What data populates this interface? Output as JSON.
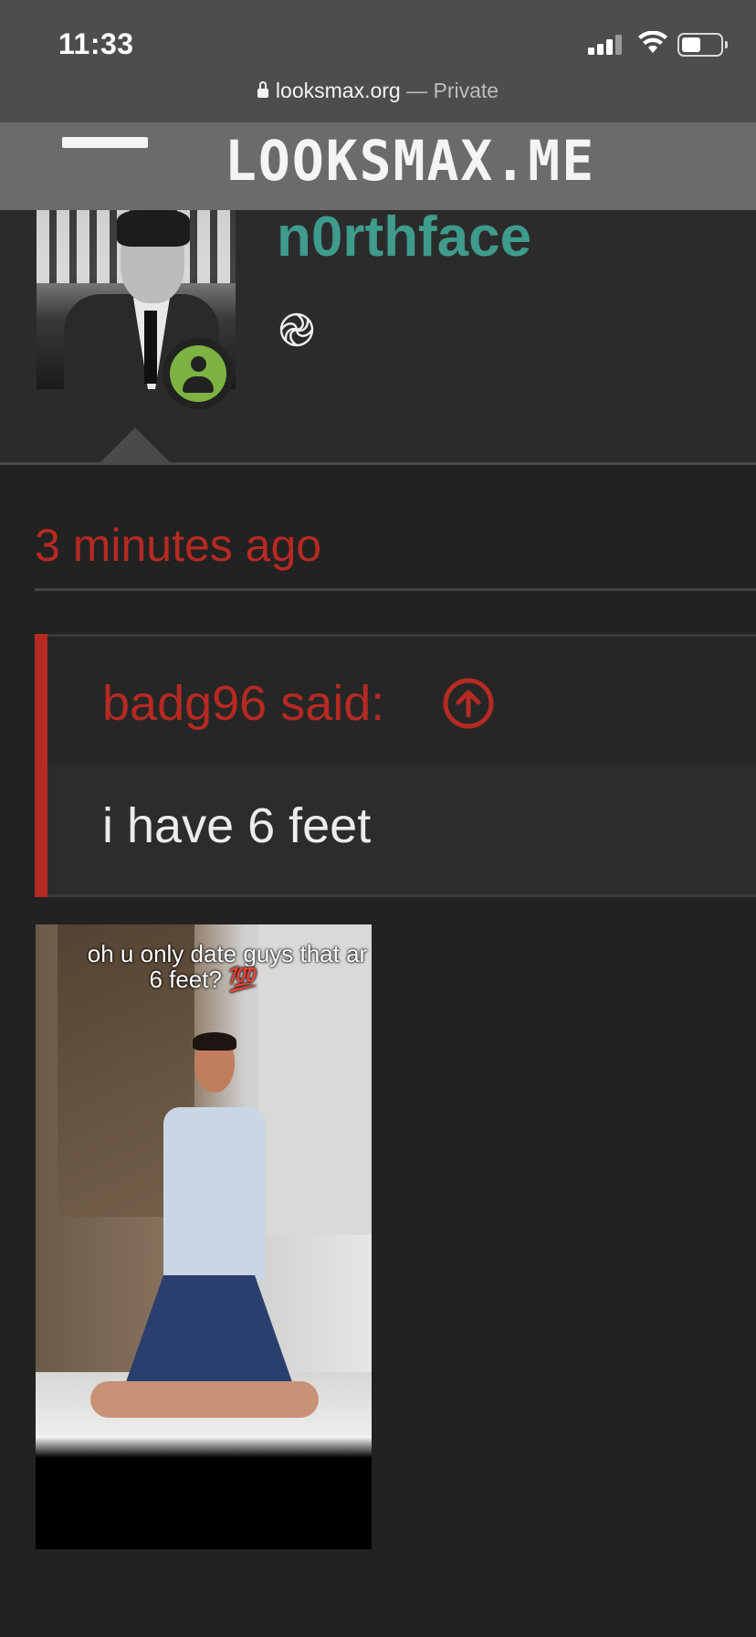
{
  "status_bar": {
    "time": "11:33"
  },
  "url_bar": {
    "domain": "looksmax.org",
    "separator": " — ",
    "mode": "Private"
  },
  "site": {
    "logo_text": "LOOKSMAX.ME"
  },
  "profile": {
    "username": "n0rthface",
    "username_color": "#3f9b8c",
    "online_status_color": "#7cb342",
    "badge_icon": "spiral-icon"
  },
  "post": {
    "timestamp": "3 minutes ago",
    "quote": {
      "author_label": "badg96 said:",
      "text": "i have 6 feet"
    },
    "image": {
      "caption_line1": "oh u only date guys that ar",
      "caption_line2": "6 feet? 💯"
    }
  },
  "colors": {
    "accent_red": "#b52a22",
    "background": "#222222"
  }
}
